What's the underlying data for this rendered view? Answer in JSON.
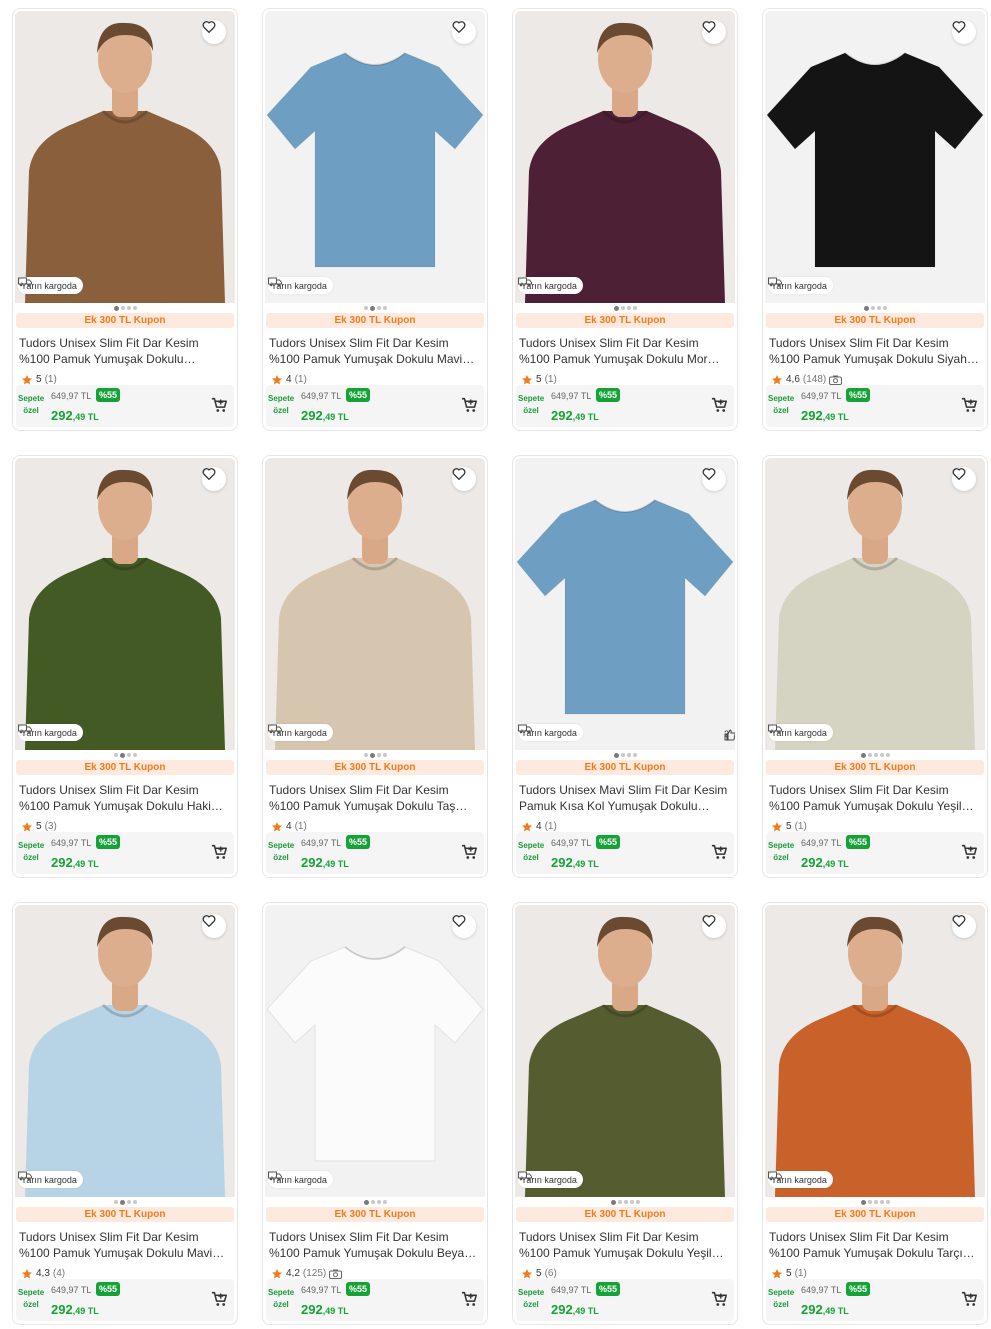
{
  "labels": {
    "shipping": "Yarın kargoda",
    "coupon": "Ek 300 TL Kupon",
    "spc_1": "Sepete",
    "spc_2": "özel",
    "old_price": "649,97 TL",
    "discount": "%55",
    "price_int": "292",
    "price_dec": ",49 TL"
  },
  "products": [
    {
      "title": "Tudors Unisex Slim Fit Dar Kesim %100 Pamuk Yumuşak Dokulu Kahverengi Bisiklet Yaka T-shirt",
      "rating": "5",
      "count": "(1)",
      "img": "model",
      "color": "#8a5f3c",
      "dots": 4,
      "active": 0
    },
    {
      "title": "Tudors Unisex Slim Fit Dar Kesim %100 Pamuk Yumuşak Dokulu Mavi Bisiklet Yaka T-shirt",
      "rating": "4",
      "count": "(1)",
      "img": "flat",
      "color": "#6e9fc2",
      "dots": 4,
      "active": 1
    },
    {
      "title": "Tudors Unisex Slim Fit Dar Kesim %100 Pamuk Yumuşak Dokulu Mor Bisiklet Yaka T-shirt",
      "rating": "5",
      "count": "(1)",
      "img": "model",
      "color": "#4d2036",
      "dots": 4,
      "active": 0
    },
    {
      "title": "Tudors Unisex Slim Fit Dar Kesim %100 Pamuk Yumuşak Dokulu Siyah Bisiklet Yaka T-shirt",
      "rating": "4,6",
      "count": "(148)",
      "img": "flat",
      "color": "#141414",
      "dots": 4,
      "active": 0,
      "camera": true
    },
    {
      "title": "Tudors Unisex Slim Fit Dar Kesim %100 Pamuk Yumuşak Dokulu Haki Bisiklet Yaka T-shirt",
      "rating": "5",
      "count": "(3)",
      "img": "model",
      "color": "#445a25",
      "dots": 4,
      "active": 1
    },
    {
      "title": "Tudors Unisex Slim Fit Dar Kesim %100 Pamuk Yumuşak Dokulu Taş Bisiklet Yaka T-shirt",
      "rating": "4",
      "count": "(1)",
      "img": "model",
      "color": "#d6c6b0",
      "dots": 4,
      "active": 1
    },
    {
      "title": "Tudors Unisex Mavi Slim Fit Dar Kesim Pamuk Kısa Kol Yumuşak Dokulu Günlük Basic T-shirt",
      "rating": "4",
      "count": "(1)",
      "img": "flat",
      "color": "#6e9fc2",
      "dots": 4,
      "active": 0,
      "review": "2"
    },
    {
      "title": "Tudors Unisex Slim Fit Dar Kesim %100 Pamuk Yumuşak Dokulu Yeşil Bisiklet Yaka T-shirt",
      "rating": "5",
      "count": "(1)",
      "img": "model",
      "color": "#d5d3c2",
      "dots": 5,
      "active": 0
    },
    {
      "title": "Tudors Unisex Slim Fit Dar Kesim %100 Pamuk Yumuşak Dokulu Mavi Bisiklet Yaka T-shirt",
      "rating": "4,3",
      "count": "(4)",
      "img": "model",
      "color": "#b7d4e6",
      "dots": 4,
      "active": 1
    },
    {
      "title": "Tudors Unisex Slim Fit Dar Kesim %100 Pamuk Yumuşak Dokulu Beyaz Bisiklet Yaka T-shirt",
      "rating": "4,2",
      "count": "(125)",
      "img": "flat",
      "color": "#fbfbfb",
      "dots": 4,
      "active": 0,
      "camera": true
    },
    {
      "title": "Tudors Unisex Slim Fit Dar Kesim %100 Pamuk Yumuşak Dokulu Yeşil Bisiklet Yaka T-shirt",
      "rating": "5",
      "count": "(6)",
      "img": "model",
      "color": "#555c30",
      "dots": 5,
      "active": 0
    },
    {
      "title": "Tudors Unisex Slim Fit Dar Kesim %100 Pamuk Yumuşak Dokulu Tarçın Renk Bisiklet Yaka T-shirt",
      "rating": "5",
      "count": "(1)",
      "img": "model",
      "color": "#c8622a",
      "dots": 5,
      "active": 0
    }
  ],
  "colors": {
    "accent_orange": "#f27a1a",
    "coupon_bg": "#fde9dd",
    "price_green": "#15a236",
    "star": "#f27a1a"
  }
}
